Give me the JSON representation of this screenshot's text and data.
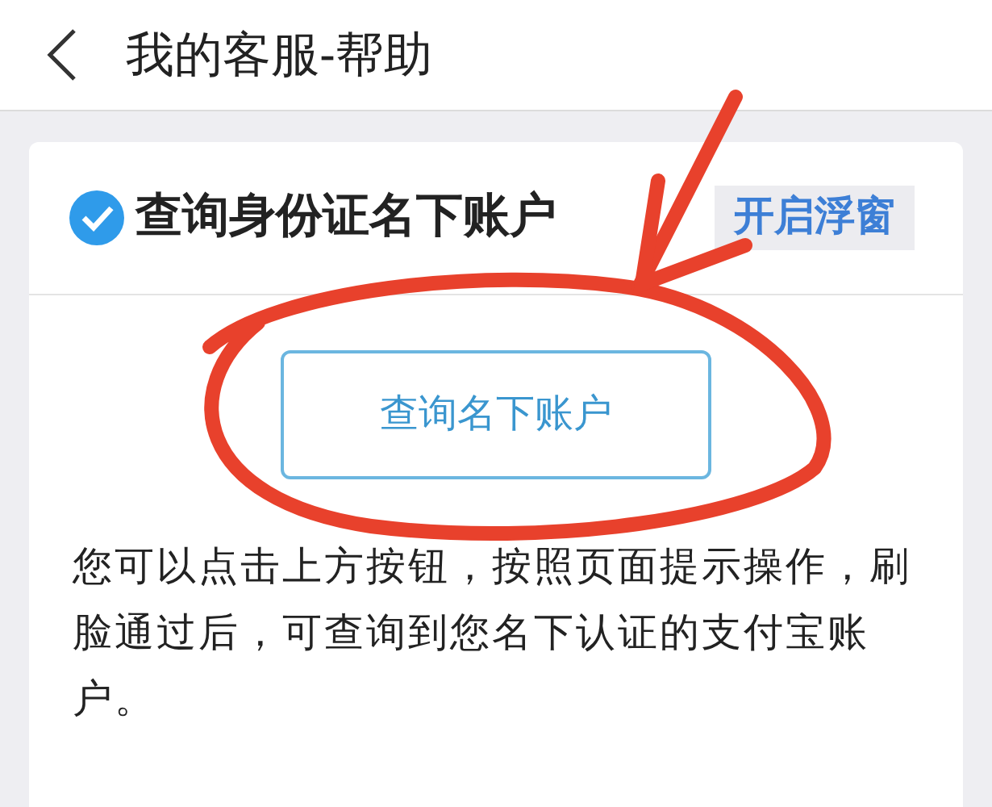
{
  "header": {
    "title": "我的客服-帮助"
  },
  "card": {
    "verified": true,
    "title": "查询身份证名下账户",
    "float_button": "开启浮窗",
    "query_button": "查询名下账户",
    "description": "您可以点击上方按钮，按照页面提示操作，刷脸通过后，可查询到您名下认证的支付宝账户。"
  }
}
